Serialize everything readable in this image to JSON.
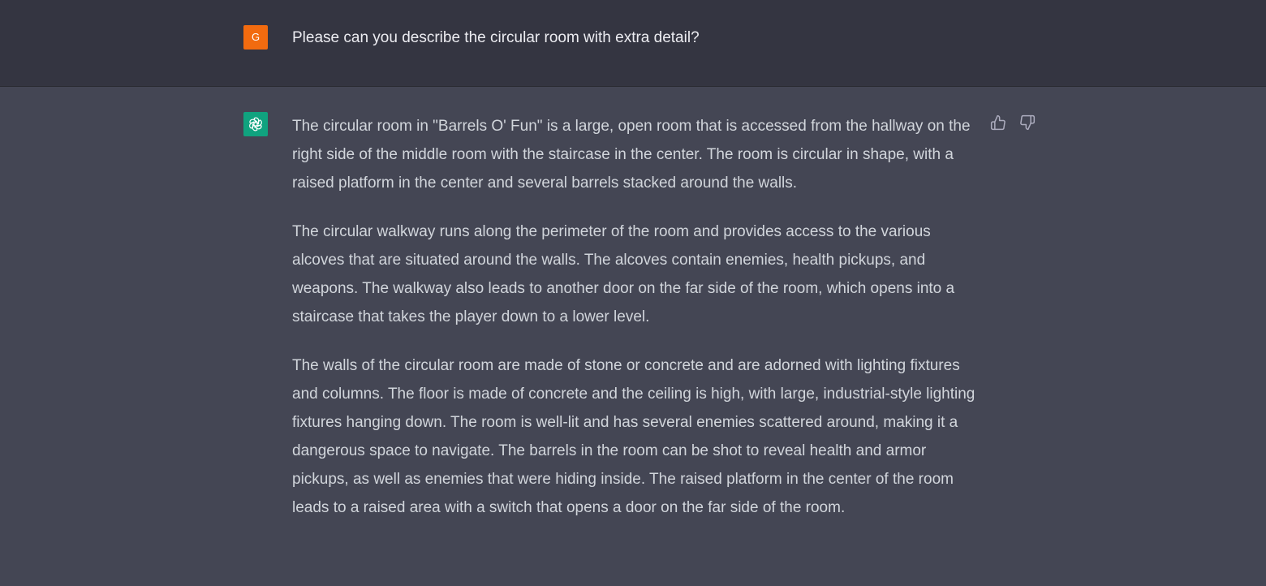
{
  "user_message": {
    "avatar_initial": "G",
    "text": "Please can you describe the circular room with extra detail?"
  },
  "assistant_message": {
    "paragraphs": [
      "The circular room in \"Barrels O' Fun\" is a large, open room that is accessed from the hallway on the right side of the middle room with the staircase in the center. The room is circular in shape, with a raised platform in the center and several barrels stacked around the walls.",
      "The circular walkway runs along the perimeter of the room and provides access to the various alcoves that are situated around the walls. The alcoves contain enemies, health pickups, and weapons. The walkway also leads to another door on the far side of the room, which opens into a staircase that takes the player down to a lower level.",
      "The walls of the circular room are made of stone or concrete and are adorned with lighting fixtures and columns. The floor is made of concrete and the ceiling is high, with large, industrial-style lighting fixtures hanging down. The room is well-lit and has several enemies scattered around, making it a dangerous space to navigate. The barrels in the room can be shot to reveal health and armor pickups, as well as enemies that were hiding inside. The raised platform in the center of the room leads to a raised area with a switch that opens a door on the far side of the room."
    ]
  },
  "icons": {
    "assistant_avatar": "openai-logo-icon",
    "thumbs_up": "thumbs-up-icon",
    "thumbs_down": "thumbs-down-icon"
  },
  "colors": {
    "user_bg": "#343541",
    "assistant_bg": "#444654",
    "user_avatar": "#f26b0f",
    "assistant_avatar": "#10a37f"
  }
}
